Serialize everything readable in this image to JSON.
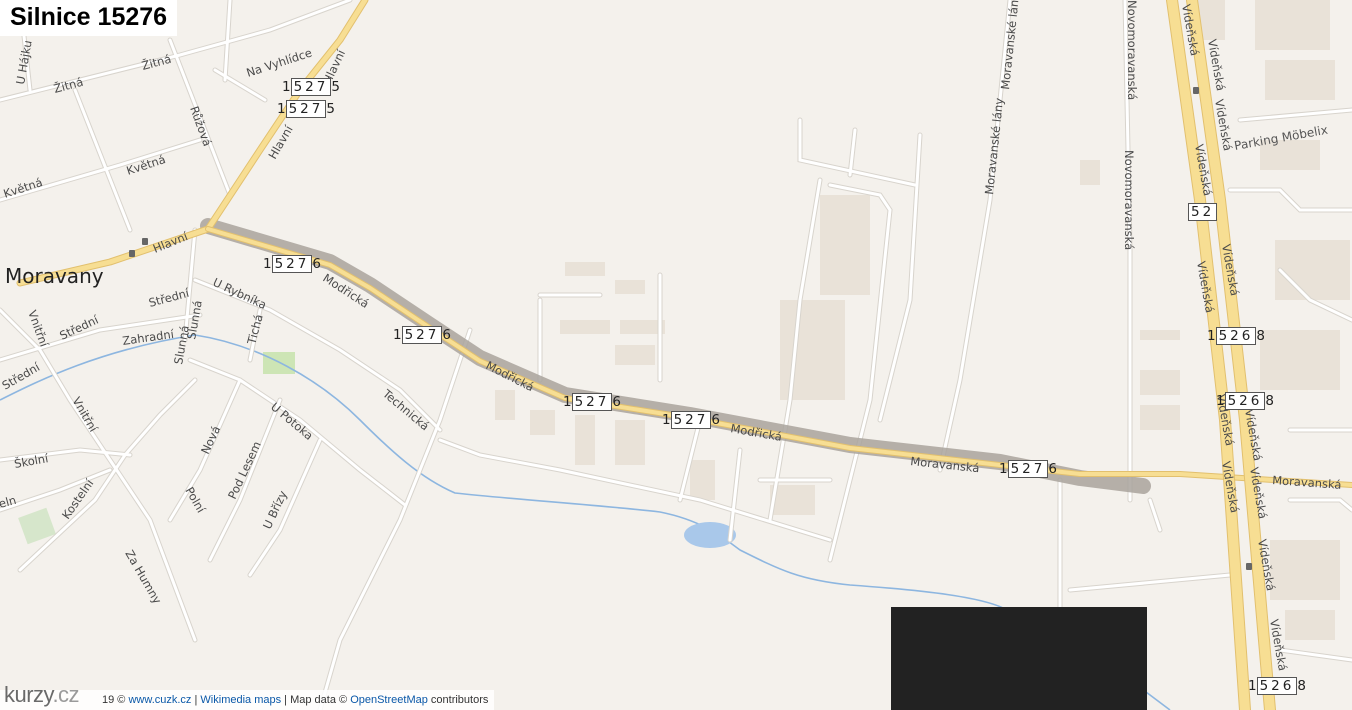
{
  "title": "Silnice 15276",
  "town": "Moravany",
  "streets": {
    "hlavni": "Hlavní",
    "modricka": "Modřická",
    "moravanska": "Moravanská",
    "videnska": "Vídeňská",
    "novomoravanska": "Novomoravanská",
    "moravanske_lany": "Moravanské lány",
    "zitna": "Žitná",
    "kvetna": "Květná",
    "ruzova": "Růžová",
    "na_vyhlidce": "Na Vyhlídce",
    "u_hajku": "U Hájku",
    "u_rybnika": "U Rybníka",
    "stredni": "Střední",
    "zahradni": "Zahradní",
    "slunna": "Slunná",
    "ticha": "Tichá",
    "technicka": "Technická",
    "vnitrni": "Vnitřní",
    "skolni": "Školní",
    "u_potoka": "U Potoka",
    "nova": "Nová",
    "pod_lesem": "Pod Lesem",
    "polni": "Polní",
    "u_brizy": "U Břízy",
    "kostelni": "Kostelní",
    "za_humny": "Za Humny"
  },
  "poi": {
    "parking": "Parking Möbelix"
  },
  "shields": {
    "r15275_a": {
      "prefix": "1",
      "box": "527",
      "suffix": "5"
    },
    "r15275_b": {
      "prefix": "1",
      "box": "527",
      "suffix": "5"
    },
    "r15276_a": {
      "prefix": "1",
      "box": "527",
      "suffix": "6"
    },
    "r15276_b": {
      "prefix": "1",
      "box": "527",
      "suffix": "6"
    },
    "r15276_c": {
      "prefix": "1",
      "box": "527",
      "suffix": "6"
    },
    "r15276_d": {
      "prefix": "1",
      "box": "527",
      "suffix": "6"
    },
    "r15276_e": {
      "prefix": "1",
      "box": "527",
      "suffix": "6"
    },
    "r15268_a": {
      "prefix": "1",
      "box": "526",
      "suffix": "8"
    },
    "r15268_b": {
      "prefix": "1",
      "box": "526",
      "suffix": "8"
    },
    "r15268_c": {
      "prefix": "1",
      "box": "526",
      "suffix": "8"
    },
    "r152_partial": {
      "box": "52"
    }
  },
  "attribution": {
    "logo_main": "kurzy",
    "logo_cz": ".cz",
    "year_fragment": "19 ©",
    "cuzk": "www.cuzk.cz",
    "sep1": "|",
    "wikimedia": "Wikimedia maps",
    "sep2": "| Map data ©",
    "osm": "OpenStreetMap",
    "contrib": "contributors"
  },
  "colors": {
    "background": "#f4f1ec",
    "minor_road": "#ffffff",
    "minor_road_casing": "#d6d2cb",
    "main_road": "#f6dc8c",
    "main_road_casing": "#e0bf6a",
    "highlight": "#a9a39c",
    "water": "#8db6e0",
    "building": "#e7dfd4",
    "park": "#cfe6b8",
    "overlay": "#222222"
  }
}
